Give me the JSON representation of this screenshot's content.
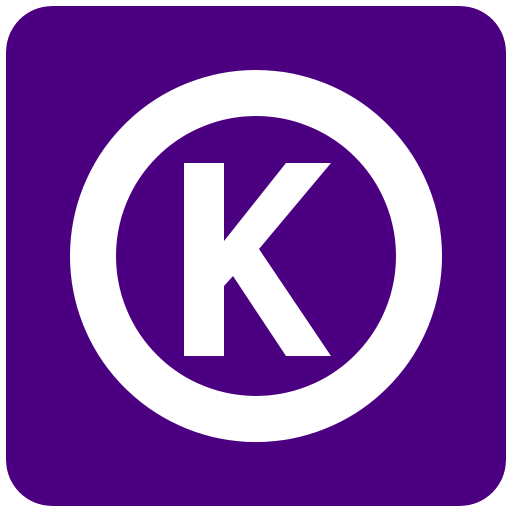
{
  "app_icon": {
    "icon_name": "k-circle-logo-icon",
    "letter": "K",
    "colors": {
      "background": "#4b0082",
      "foreground": "#ffffff"
    }
  }
}
